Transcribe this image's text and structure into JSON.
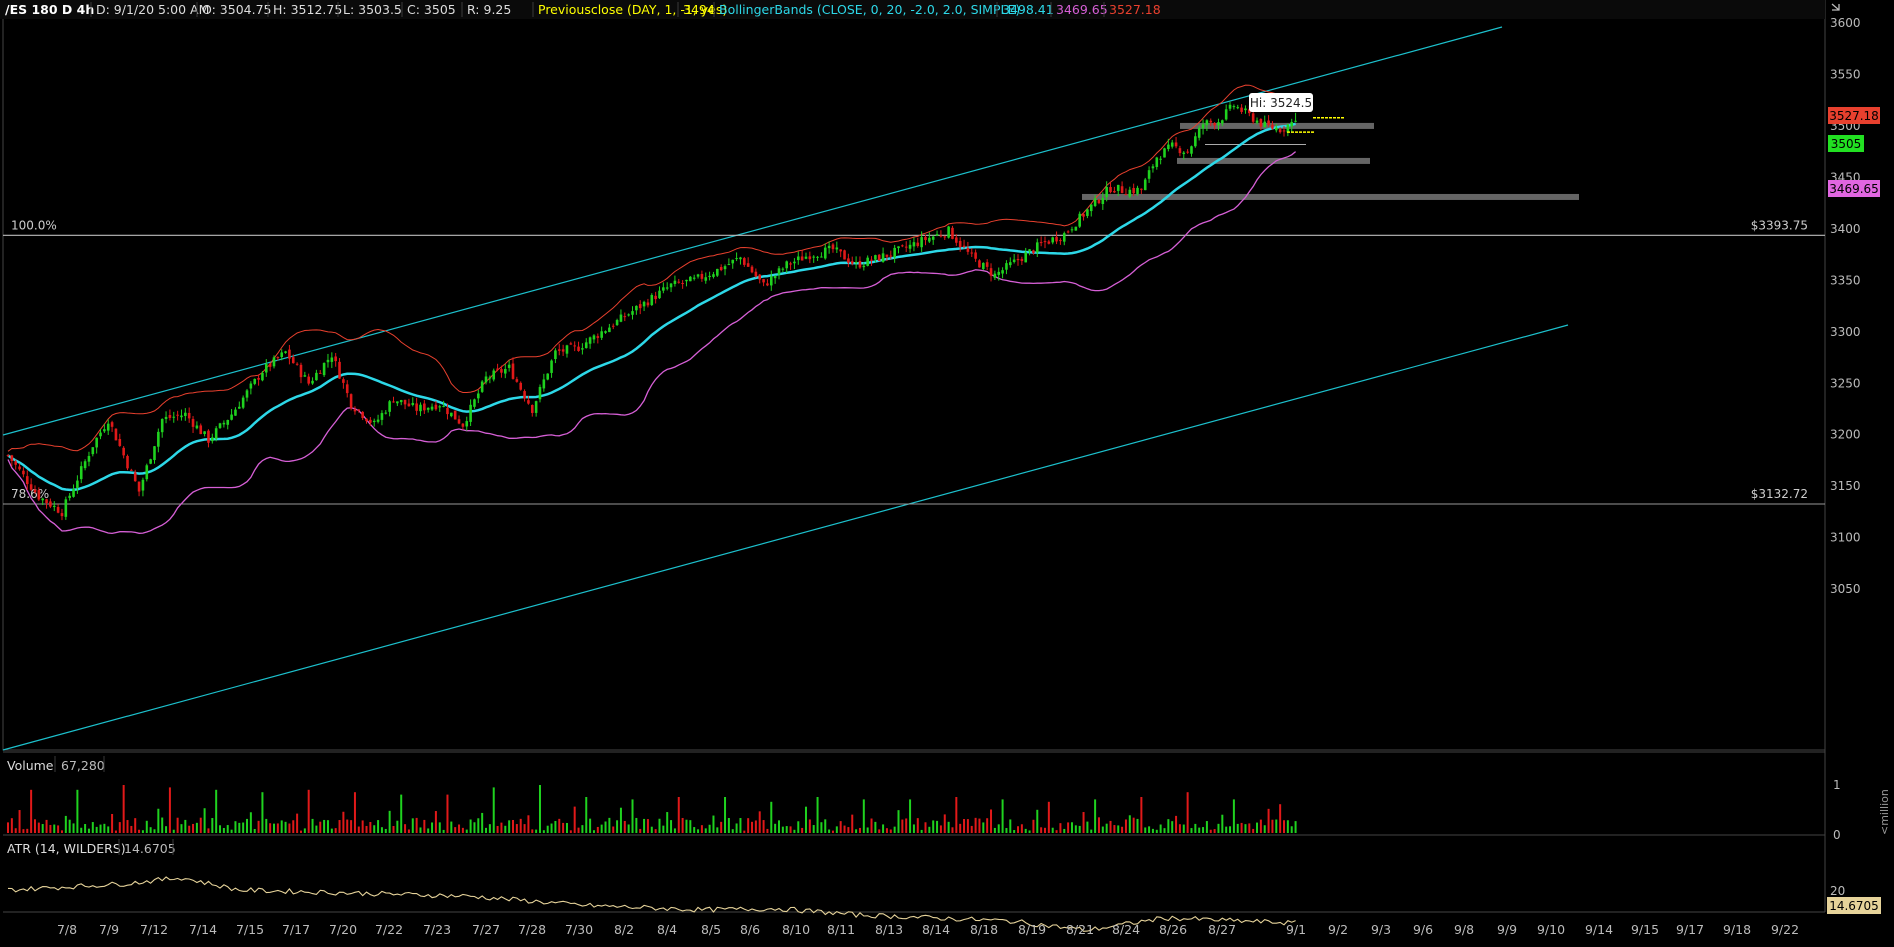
{
  "header": {
    "symbol": "/ES 180 D 4h",
    "date": "D: 9/1/20 5:00 AM",
    "open": "O: 3504.75",
    "high": "H: 3512.75",
    "low": "L: 3503.5",
    "close": "C: 3505",
    "range": "R: 9.25",
    "prevclose_label": "Previousclose (DAY, 1, -1, yes)",
    "prevclose_value": "3494",
    "bb_label": "BollingerBands (CLOSE, 0, 20, -2.0, 2.0, SIMPLE)",
    "bb_mid": "3498.41",
    "bb_lower": "3469.65",
    "bb_upper": "3527.18"
  },
  "colors": {
    "up": "#1fd21f",
    "down": "#e11919",
    "mid": "#2dd8e8",
    "upper": "#e8402e",
    "lower": "#d65fd6",
    "channel": "#1cc0cc",
    "atr": "#e6d39a",
    "prevclose": "#ffff00"
  },
  "price_axis": {
    "ticks": [
      "3600",
      "3550",
      "3500",
      "3450",
      "3400",
      "3350",
      "3300",
      "3250",
      "3200",
      "3150",
      "3100",
      "3050"
    ],
    "last_upper": "3527.18",
    "last_close": "3505",
    "last_lower": "3469.65"
  },
  "fib": {
    "level_100_label": "100.0%",
    "level_100_price": "$3393.75",
    "level_78_label": "78.6%",
    "level_78_price": "$3132.72"
  },
  "annotation": {
    "hi_label": "Hi: 3524.5"
  },
  "volume": {
    "label": "Volume",
    "value": "67,280",
    "axis_top": "1",
    "axis_bottom": "0",
    "unit": "<million"
  },
  "atr": {
    "label": "ATR (14, WILDERS)",
    "value": "14.6705",
    "axis_tick": "20",
    "last": "14.6705"
  },
  "x_axis": {
    "labels": [
      "7/8",
      "7/9",
      "7/12",
      "7/14",
      "7/15",
      "7/17",
      "7/20",
      "7/22",
      "7/23",
      "7/27",
      "7/28",
      "7/30",
      "8/2",
      "8/4",
      "8/5",
      "8/6",
      "8/10",
      "8/11",
      "8/13",
      "8/14",
      "8/18",
      "8/19",
      "8/21",
      "8/24",
      "8/26",
      "8/27",
      "9/1",
      "9/2",
      "9/3",
      "9/6",
      "9/8",
      "9/9",
      "9/10",
      "9/14",
      "9/15",
      "9/17",
      "9/18",
      "9/22"
    ]
  },
  "chart_data": {
    "type": "candlestick",
    "series_label": "/ES 180 D 4h",
    "ylim": [
      3020,
      3610
    ],
    "last_bar": {
      "open": 3504.75,
      "high": 3512.75,
      "low": 3503.5,
      "close": 3505,
      "range": 9.25
    },
    "bollinger": {
      "mid": 3498.41,
      "lower": 3469.65,
      "upper": 3527.18
    },
    "previous_close": 3494,
    "high_annotation": 3524.5,
    "fib_levels": [
      {
        "label": "100.0%",
        "price": 3393.75
      },
      {
        "label": "78.6%",
        "price": 3132.72
      }
    ],
    "close_anchors": [
      [
        0,
        3180
      ],
      [
        8,
        3140
      ],
      [
        14,
        3125
      ],
      [
        22,
        3190
      ],
      [
        26,
        3215
      ],
      [
        34,
        3145
      ],
      [
        40,
        3215
      ],
      [
        46,
        3220
      ],
      [
        52,
        3195
      ],
      [
        58,
        3220
      ],
      [
        66,
        3262
      ],
      [
        72,
        3280
      ],
      [
        78,
        3250
      ],
      [
        84,
        3278
      ],
      [
        89,
        3230
      ],
      [
        95,
        3210
      ],
      [
        100,
        3235
      ],
      [
        106,
        3225
      ],
      [
        112,
        3230
      ],
      [
        118,
        3210
      ],
      [
        124,
        3255
      ],
      [
        130,
        3265
      ],
      [
        136,
        3225
      ],
      [
        142,
        3280
      ],
      [
        148,
        3285
      ],
      [
        154,
        3300
      ],
      [
        160,
        3315
      ],
      [
        166,
        3330
      ],
      [
        172,
        3345
      ],
      [
        178,
        3350
      ],
      [
        184,
        3360
      ],
      [
        190,
        3372
      ],
      [
        196,
        3345
      ],
      [
        202,
        3365
      ],
      [
        208,
        3375
      ],
      [
        214,
        3380
      ],
      [
        220,
        3365
      ],
      [
        226,
        3372
      ],
      [
        232,
        3380
      ],
      [
        238,
        3390
      ],
      [
        244,
        3398
      ],
      [
        250,
        3372
      ],
      [
        256,
        3355
      ],
      [
        262,
        3370
      ],
      [
        268,
        3385
      ],
      [
        274,
        3395
      ],
      [
        280,
        3418
      ],
      [
        286,
        3440
      ],
      [
        290,
        3437
      ],
      [
        294,
        3438
      ],
      [
        298,
        3470
      ],
      [
        302,
        3480
      ],
      [
        306,
        3475
      ],
      [
        310,
        3502
      ],
      [
        314,
        3505
      ],
      [
        318,
        3520
      ],
      [
        322,
        3510
      ],
      [
        326,
        3500
      ],
      [
        330,
        3497
      ],
      [
        334,
        3505
      ]
    ],
    "volume_spikes_millions": [
      0.9,
      0.9,
      1.0,
      0.95,
      0.9,
      0.85,
      0.9,
      0.85,
      0.8,
      0.8,
      0.95,
      1.0,
      0.75,
      0.7,
      0.75,
      0.75,
      0.65,
      0.75,
      0.7,
      0.7,
      0.75,
      0.7,
      0.65,
      0.7,
      0.75,
      0.85,
      0.7,
      0.6
    ],
    "atr_anchors": [
      [
        0,
        20
      ],
      [
        30,
        21
      ],
      [
        45,
        22
      ],
      [
        60,
        20
      ],
      [
        90,
        19.5
      ],
      [
        120,
        19
      ],
      [
        150,
        17.5
      ],
      [
        180,
        16.8
      ],
      [
        200,
        17
      ],
      [
        220,
        16
      ],
      [
        260,
        15
      ],
      [
        280,
        13.5
      ],
      [
        300,
        15.5
      ],
      [
        320,
        15
      ],
      [
        334,
        14.67
      ]
    ]
  }
}
